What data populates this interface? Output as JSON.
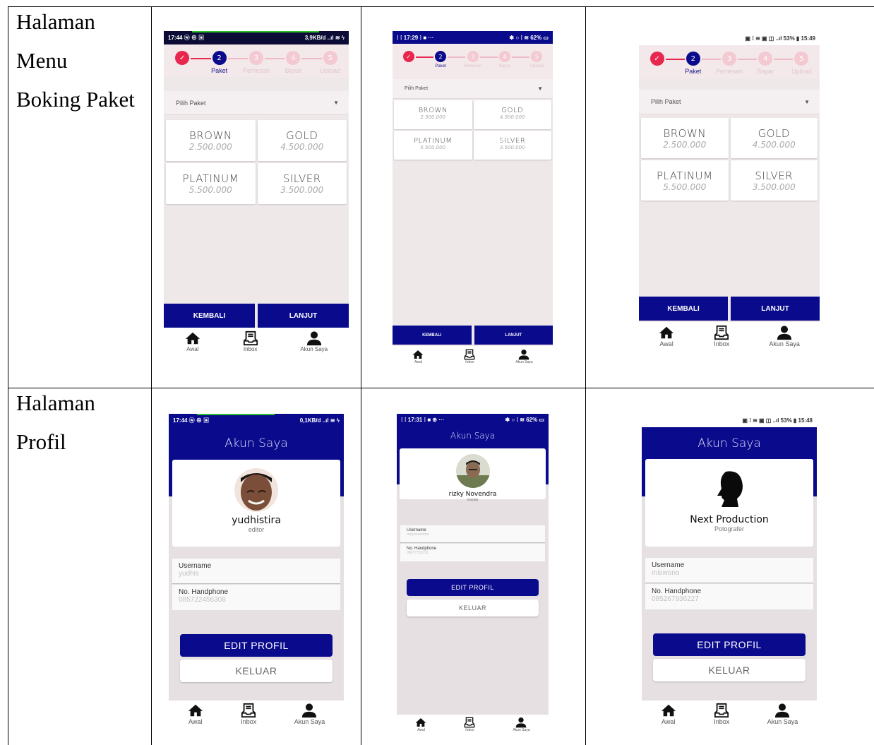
{
  "rows": [
    {
      "label_lines": [
        "Halaman",
        "Menu",
        "Boking Paket"
      ]
    },
    {
      "label_lines": [
        "Halaman",
        "Profil"
      ]
    }
  ],
  "booking": {
    "status_bars": [
      {
        "left": "17:44 ⓦ ⊕ ▣",
        "right": "3,9KB/d ..ıl ≋ ϟ"
      },
      {
        "left": "⁞ ⁞ 17:29 ⁞ ■ ···",
        "right": "✱ ○ ⁞ ≋ 62% ▭"
      },
      {
        "left": "",
        "right": "▣ ⁞ ≋ ▣ ◫ ..ıl 53% ▮ 15:49"
      }
    ],
    "steps": [
      {
        "num": "✓",
        "label": "",
        "state": "done"
      },
      {
        "num": "2",
        "label": "Paket",
        "state": "active"
      },
      {
        "num": "3",
        "label": "Pemesan",
        "state": "todo"
      },
      {
        "num": "4",
        "label": "Bayar",
        "state": "todo"
      },
      {
        "num": "5",
        "label": "Upload",
        "state": "todo"
      }
    ],
    "select_label": "Pilih Paket",
    "packages": [
      {
        "name": "BROWN",
        "price": "2.500.000"
      },
      {
        "name": "GOLD",
        "price": "4.500.000"
      },
      {
        "name": "PLATINUM",
        "price": "5.500.000"
      },
      {
        "name": "SILVER",
        "price": "3.500.000"
      }
    ],
    "back_label": "KEMBALI",
    "next_label": "LANJUT"
  },
  "nav": [
    {
      "label": "Awal",
      "icon": "home-icon"
    },
    {
      "label": "Inbox",
      "icon": "inbox-icon"
    },
    {
      "label": "Akun Saya",
      "icon": "user-icon"
    }
  ],
  "profile": {
    "status_bars": [
      {
        "left": "17:44 ⓦ ⊕ ▣",
        "right": "0,1KB/d ..ıl ≋ ϟ"
      },
      {
        "left": "⁞ ⁞ 17:31 ⁞ ■ ⊕ ···",
        "right": "✱ ○ ⁞ ≋ 62% ▭"
      },
      {
        "left": "",
        "right": "▣ ⁞ ≋ ▣ ◫ ..ıl 53% ▮ 15:48"
      }
    ],
    "title": "Akun Saya",
    "username_label": "Username",
    "phone_label": "No. Handphone",
    "edit_label": "EDIT PROFIL",
    "logout_label": "KELUAR",
    "users": [
      {
        "name": "yudhistira",
        "role": "editor",
        "username": "yudhis",
        "phone": "085722456308"
      },
      {
        "name": "rizky Novendra",
        "role": "wasata",
        "username": "rizkynovendra",
        "phone": "08877732210"
      },
      {
        "name": "Next Production",
        "role": "Potografer",
        "username": "miswono",
        "phone": "085267936227"
      }
    ]
  },
  "colors": {
    "primary": "#0a0a8c",
    "accent": "#e8274f",
    "background": "#eee8e9"
  }
}
